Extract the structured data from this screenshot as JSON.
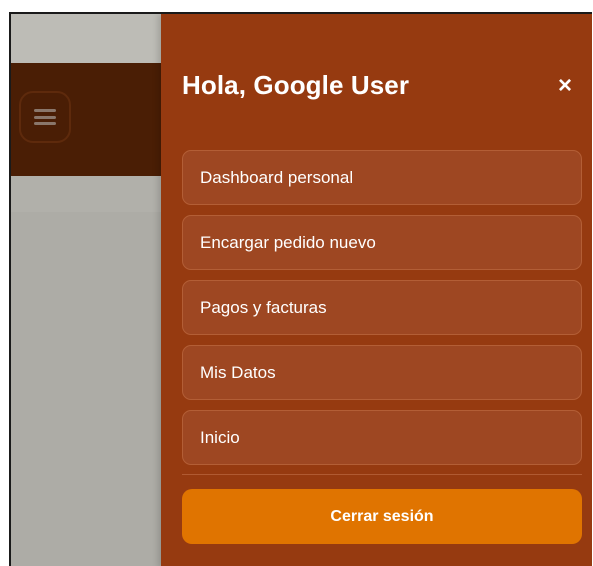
{
  "drawer": {
    "title": "Hola, Google User",
    "close_label": "×",
    "nav_items": [
      {
        "label": "Dashboard personal"
      },
      {
        "label": "Encargar pedido nuevo"
      },
      {
        "label": "Pagos y facturas"
      },
      {
        "label": "Mis Datos"
      },
      {
        "label": "Inicio"
      }
    ],
    "logout_label": "Cerrar sesión"
  },
  "background": {
    "menu_icon": "hamburger-menu-icon"
  },
  "colors": {
    "drawer_bg": "#963a10",
    "nav_item_bg": "#9e4722",
    "logout_bg": "#e07400",
    "header_bg": "#4a1e05"
  }
}
